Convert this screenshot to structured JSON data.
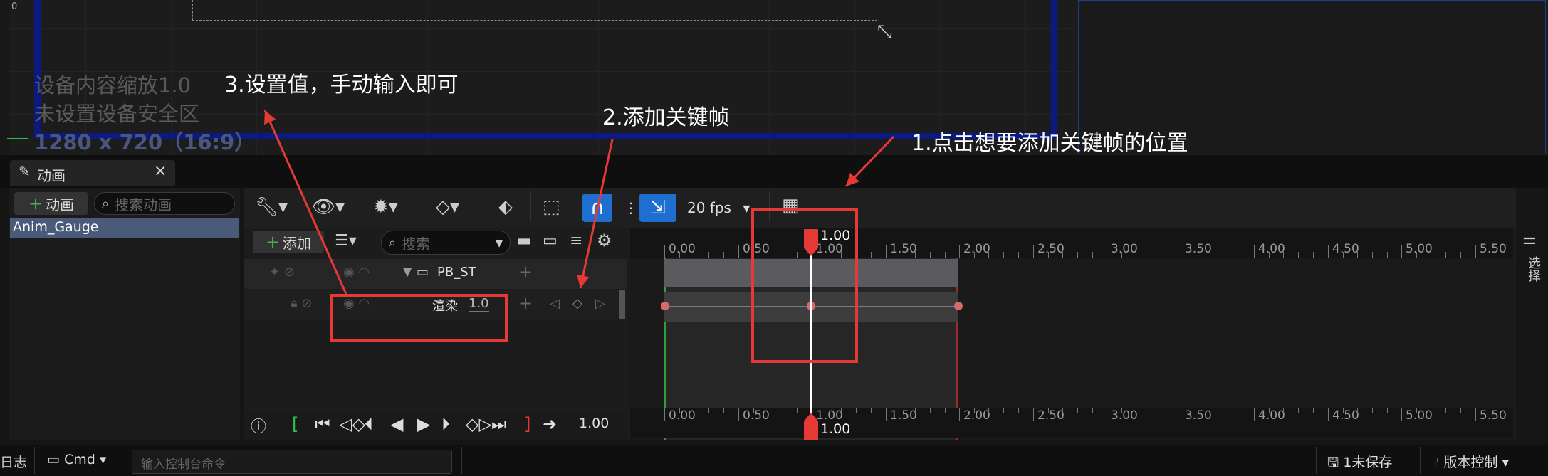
{
  "viewport": {
    "axis_zero": "0",
    "info_lines": [
      "设备内容缩放1.0",
      "未设置设备安全区",
      "1280 x 720（16:9）"
    ]
  },
  "annotations": {
    "step1": "1.点击想要添加关键帧的位置",
    "step2": "2.添加关键帧",
    "step3": "3.设置值，手动输入即可"
  },
  "tab": {
    "label": "动画",
    "close": "×"
  },
  "left_panel": {
    "add_button": "动画",
    "search_placeholder": "搜索动画",
    "items": [
      "Anim_Gauge"
    ]
  },
  "toolbar": {
    "fps": "20 fps"
  },
  "tracks": {
    "add_button": "添加",
    "search_placeholder": "搜索",
    "widget_name": "PB_ST",
    "property_name": "渲染",
    "property_value": "1.0"
  },
  "timeline": {
    "ticks": [
      "0.00",
      "0.50",
      "1.00",
      "1.50",
      "2.00",
      "2.50",
      "3.00",
      "3.50",
      "4.00",
      "4.50",
      "5.00",
      "5.50"
    ],
    "playhead": "1.00",
    "time_value": "1.00"
  },
  "right_strip": {
    "label": "选择"
  },
  "statusbar": {
    "log": "日志",
    "cmd": "Cmd",
    "console_placeholder": "输入控制台命令",
    "unsaved": "1未保存",
    "version_control": "版本控制"
  },
  "colors": {
    "accent_blue": "#1f6fd1",
    "keyframe_red": "#e53935",
    "frame_blue": "#0b1a80"
  }
}
